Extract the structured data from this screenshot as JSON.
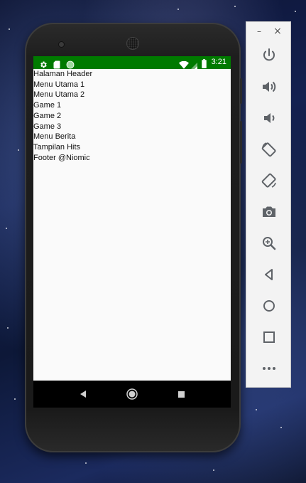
{
  "status_bar": {
    "time": "3:21",
    "background_color": "#007a00",
    "left_icons": [
      "settings-icon",
      "sd-card-icon",
      "sync-dot-icon"
    ],
    "right_icons": [
      "wifi-icon",
      "cell-signal-icon",
      "battery-icon"
    ]
  },
  "content": {
    "items": [
      "Halaman Header",
      "Menu Utama 1",
      "Menu Utama 2",
      "Game 1",
      "Game 2",
      "Game 3",
      "Menu Berita",
      "Tampilan Hits",
      "Footer @Niomic"
    ]
  },
  "nav_bar": {
    "buttons": [
      "back-triangle-icon",
      "home-circle-icon",
      "recents-square-icon"
    ]
  },
  "emulator_panel": {
    "minimize_label": "–",
    "close_label": "×",
    "tools": [
      "power-icon",
      "volume-up-icon",
      "volume-down-icon",
      "rotate-left-icon",
      "rotate-right-icon",
      "camera-icon",
      "zoom-icon",
      "back-icon",
      "home-icon",
      "overview-icon",
      "more-icon"
    ]
  }
}
